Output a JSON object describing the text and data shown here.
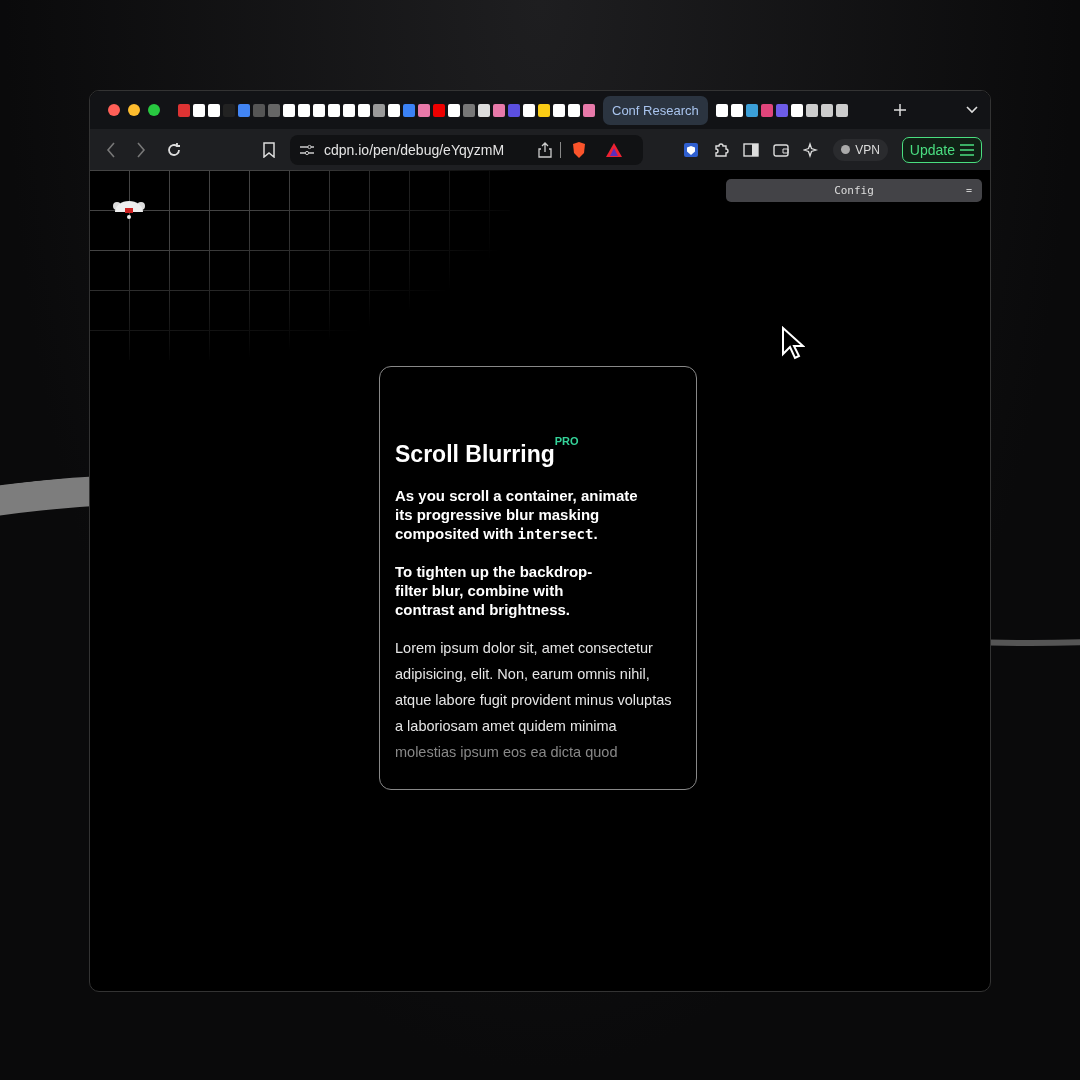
{
  "browser": {
    "tabs": [
      {
        "label": "Conf Research",
        "selected": true
      }
    ],
    "address": "cdpn.io/pen/debug/eYqyzmM",
    "vpn_label": "VPN",
    "update_label": "Update"
  },
  "config_panel": {
    "title": "Config",
    "handle": "="
  },
  "card": {
    "title": "Scroll Blurring",
    "badge": "PRO",
    "paragraphs": [
      [
        {
          "text": "As you scroll a container, animate its progressive blur masking composited with ",
          "kind": "text"
        },
        {
          "text": "intersect",
          "kind": "code"
        },
        {
          "text": ".",
          "kind": "text"
        }
      ],
      [
        {
          "text": "To tighten up the backdrop-filter blur, combine with contrast and brightness.",
          "kind": "text"
        }
      ]
    ],
    "body_lines": [
      {
        "text": "Lorem ipsum dolor sit, amet consectetur",
        "blurred": false
      },
      {
        "text": "adipisicing, elit. Non, earum omnis nihil,",
        "blurred": false
      },
      {
        "text": "atque labore fugit provident minus voluptas",
        "blurred": false
      },
      {
        "text": "a laboriosam amet quidem minima",
        "blurred": false
      },
      {
        "text": "molestias ipsum eos ea dicta quod",
        "blurred": true
      }
    ]
  }
}
